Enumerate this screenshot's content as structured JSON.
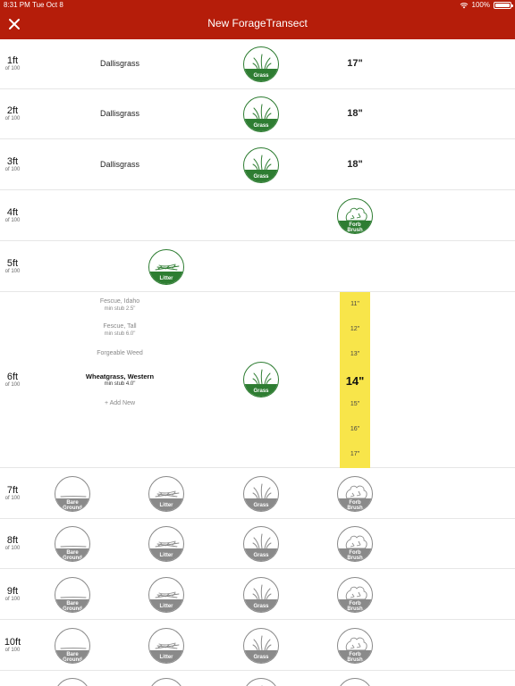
{
  "status": {
    "time": "8:31 PM",
    "date": "Tue Oct 8",
    "battery": "100%",
    "battery_level": 1.0
  },
  "header": {
    "title": "New ForageTransect"
  },
  "badge_labels": {
    "grass": "Grass",
    "litter": "Litter",
    "forb_line1": "Forb",
    "forb_line2": "Brush",
    "bare_line1": "Bare",
    "bare_line2": "Ground"
  },
  "rows": [
    {
      "ft": "1ft",
      "of": "of 100",
      "species": "Dallisgrass",
      "height": "17\""
    },
    {
      "ft": "2ft",
      "of": "of 100",
      "species": "Dallisgrass",
      "height": "18\""
    },
    {
      "ft": "3ft",
      "of": "of 100",
      "species": "Dallisgrass",
      "height": "18\""
    },
    {
      "ft": "4ft",
      "of": "of 100"
    },
    {
      "ft": "5ft",
      "of": "of 100"
    },
    {
      "ft": "6ft",
      "of": "of 100"
    },
    {
      "ft": "7ft",
      "of": "of 100"
    },
    {
      "ft": "8ft",
      "of": "of 100"
    },
    {
      "ft": "9ft",
      "of": "of 100"
    },
    {
      "ft": "10ft",
      "of": "of 100"
    }
  ],
  "species_picker": [
    {
      "name": "Fescue, Idaho",
      "sub": "min stub 2.5\""
    },
    {
      "name": "Fescue, Tall",
      "sub": "min stub 6.0\""
    },
    {
      "name": "Forgeable Weed",
      "sub": ""
    },
    {
      "name": "Wheatgrass, Western",
      "sub": "min stub 4.0\"",
      "selected": true
    },
    {
      "name": "+ Add New",
      "sub": ""
    }
  ],
  "height_picker": [
    {
      "value": "11\""
    },
    {
      "value": "12\""
    },
    {
      "value": "13\""
    },
    {
      "value": "14\"",
      "selected": true
    },
    {
      "value": "15\""
    },
    {
      "value": "16\""
    },
    {
      "value": "17\""
    }
  ]
}
